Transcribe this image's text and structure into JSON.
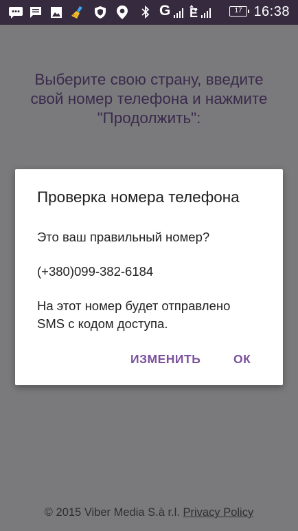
{
  "status_bar": {
    "time": "16:38",
    "battery_level": "17",
    "network_primary": "G",
    "network_secondary": "E",
    "icons": [
      "chat-icon",
      "message-icon",
      "gallery-icon",
      "cleaner-icon",
      "shield-icon",
      "location-icon",
      "bluetooth-icon",
      "signal-icon",
      "battery-icon"
    ]
  },
  "screen": {
    "instruction_lines": [
      "Выберите свою страну, введите",
      "свой номер телефона и нажмите",
      "\"Продолжить\":"
    ],
    "footer_copyright": "© 2015 Viber Media S.à r.l.",
    "footer_link": "Privacy Policy"
  },
  "dialog": {
    "title": "Проверка номера телефона",
    "question": "Это ваш правильный номер?",
    "phone": "(+380)099-382-6184",
    "note_lines": [
      "На этот номер будет отправлено",
      "SMS с кодом доступа."
    ],
    "buttons": {
      "change": "ИЗМЕНИТЬ",
      "ok": "ОК"
    }
  },
  "colors": {
    "status_bar_bg": "#352a3e",
    "scrim_bg": "#7a7a7c",
    "accent": "#7b519d"
  }
}
